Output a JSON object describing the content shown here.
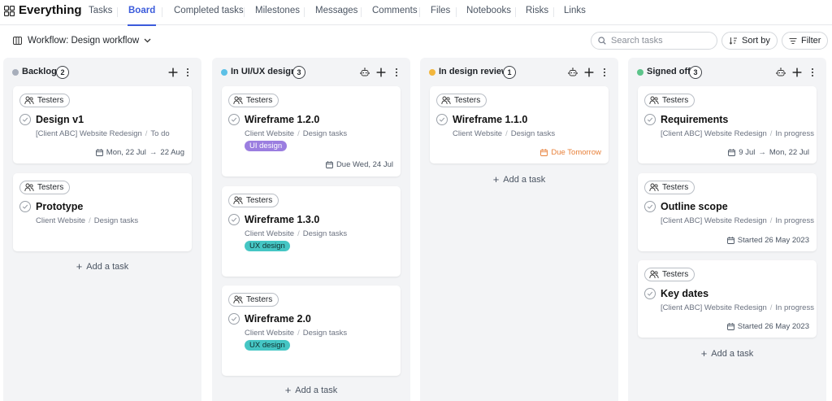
{
  "app": {
    "title": "Everything"
  },
  "tabs": [
    {
      "label": "Tasks"
    },
    {
      "label": "Board",
      "active": true
    },
    {
      "label": "Completed tasks"
    },
    {
      "label": "Milestones"
    },
    {
      "label": "Messages"
    },
    {
      "label": "Comments"
    },
    {
      "label": "Files"
    },
    {
      "label": "Notebooks"
    },
    {
      "label": "Risks"
    },
    {
      "label": "Links"
    }
  ],
  "toolbar": {
    "workflow_label": "Workflow: Design workflow",
    "search_placeholder": "Search tasks",
    "sort_label": "Sort by",
    "filter_label": "Filter"
  },
  "colors": {
    "accent": "#3b5bdb",
    "backlog": "#a7aebb",
    "in_ui_ux": "#5cc0e6",
    "in_review": "#f2b63d",
    "signed_off": "#5cc48a",
    "ui_design_chip": "#9b7ee0",
    "ux_design_chip": "#45c6c4",
    "due_soon": "#e8813a"
  },
  "common": {
    "tag_label": "Testers",
    "add_task_label": "Add a task"
  },
  "columns": [
    {
      "title": "Backlog",
      "count": "2",
      "cards": [
        {
          "title": "Design v1",
          "project": "[Client ABC] Website Redesign",
          "status": "To do",
          "date_start": "Mon, 22 Jul",
          "date_end": "22 Aug"
        },
        {
          "title": "Prototype",
          "project": "Client Website",
          "status": "Design tasks"
        }
      ]
    },
    {
      "title": "In UI/UX design",
      "count": "3",
      "cards": [
        {
          "title": "Wireframe 1.2.0",
          "project": "Client Website",
          "status": "Design tasks",
          "chip": "UI design",
          "date": "Due Wed, 24 Jul"
        },
        {
          "title": "Wireframe 1.3.0",
          "project": "Client Website",
          "status": "Design tasks",
          "chip": "UX design"
        },
        {
          "title": "Wireframe 2.0",
          "project": "Client Website",
          "status": "Design tasks",
          "chip": "UX design"
        }
      ]
    },
    {
      "title": "In design review",
      "count": "1",
      "cards": [
        {
          "title": "Wireframe 1.1.0",
          "project": "Client Website",
          "status": "Design tasks",
          "date": "Due Tomorrow"
        }
      ]
    },
    {
      "title": "Signed off",
      "count": "3",
      "cards": [
        {
          "title": "Requirements",
          "project": "[Client ABC] Website Redesign",
          "status": "In progress",
          "date_start": "9 Jul",
          "date_end": "Mon, 22 Jul"
        },
        {
          "title": "Outline scope",
          "project": "[Client ABC] Website Redesign",
          "status": "In progress",
          "date": "Started 26 May 2023"
        },
        {
          "title": "Key dates",
          "project": "[Client ABC] Website Redesign",
          "status": "In progress",
          "date": "Started 26 May 2023"
        }
      ]
    }
  ]
}
